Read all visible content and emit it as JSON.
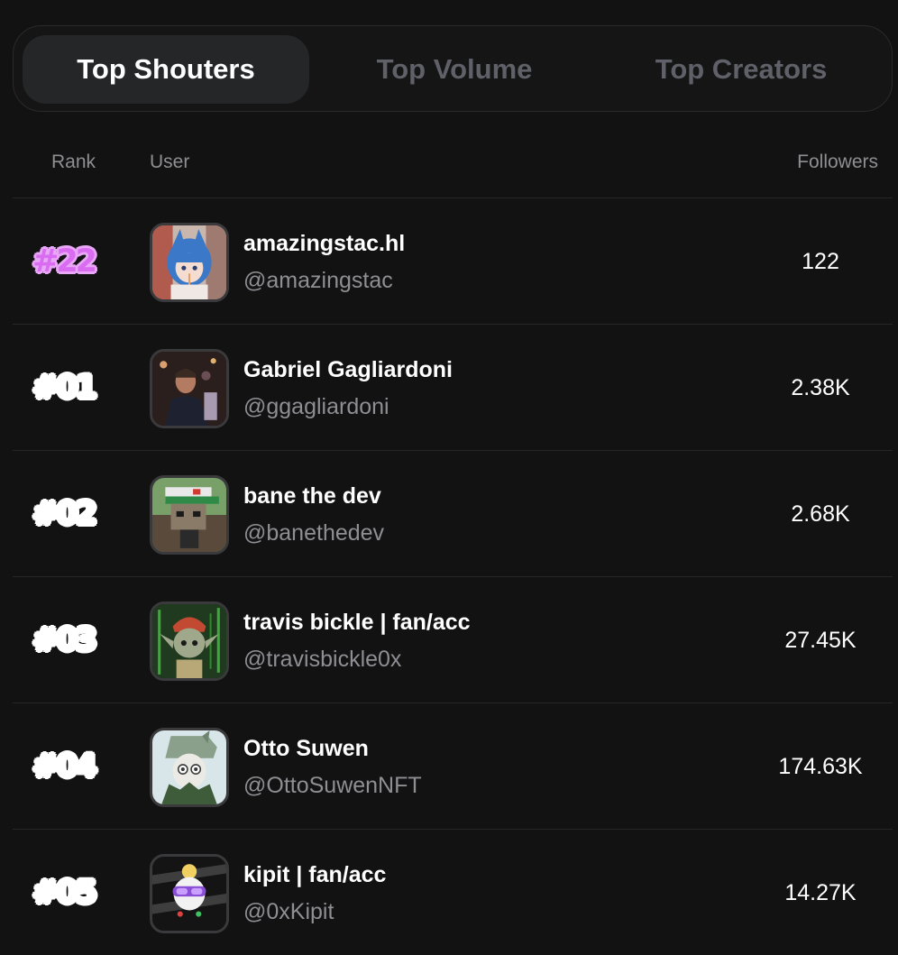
{
  "tabs": [
    {
      "label": "Top Shouters",
      "active": true
    },
    {
      "label": "Top Volume",
      "active": false
    },
    {
      "label": "Top Creators",
      "active": false
    }
  ],
  "columns": {
    "rank": "Rank",
    "user": "User",
    "followers": "Followers"
  },
  "rows": [
    {
      "rank": "#22",
      "name": "amazingstac.hl",
      "handle": "@amazingstac",
      "followers": "122",
      "current_user": true,
      "avatar": "anime-girl-avatar"
    },
    {
      "rank": "#01",
      "name": "Gabriel Gagliardoni",
      "handle": "@ggagliardoni",
      "followers": "2.38K",
      "current_user": false,
      "avatar": "photo-avatar"
    },
    {
      "rank": "#02",
      "name": "bane the dev",
      "handle": "@banethedev",
      "followers": "2.68K",
      "current_user": false,
      "avatar": "pixel-cap-avatar"
    },
    {
      "rank": "#03",
      "name": "travis bickle | fan/acc",
      "handle": "@travisbickle0x",
      "followers": "27.45K",
      "current_user": false,
      "avatar": "elf-avatar"
    },
    {
      "rank": "#04",
      "name": "Otto Suwen",
      "handle": "@OttoSuwenNFT",
      "followers": "174.63K",
      "current_user": false,
      "avatar": "hooded-avatar"
    },
    {
      "rank": "#05",
      "name": "kipit | fan/acc",
      "handle": "@0xKipit",
      "followers": "14.27K",
      "current_user": false,
      "avatar": "goggles-avatar"
    }
  ],
  "colors": {
    "background": "#121212",
    "highlight_rank": "#d96cf0",
    "muted": "#8e8e93"
  }
}
